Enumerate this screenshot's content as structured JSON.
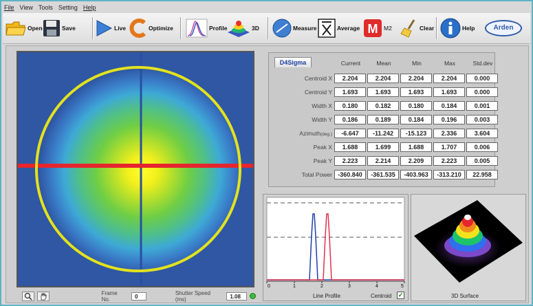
{
  "menu": [
    "File",
    "View",
    "Tools",
    "Setting",
    "Help"
  ],
  "toolbar": {
    "open": "Open",
    "save": "Save",
    "live": "Live",
    "optimize": "Optimize",
    "profile": "Profile",
    "three_d": "3D",
    "measure": "Measure",
    "average": "Average",
    "m2": "M2",
    "clear": "Clear",
    "help": "Help",
    "logo": "Arden"
  },
  "status": {
    "frame_label": "Frame No.",
    "frame_value": "0",
    "shutter_label": "Shutter Speed (ms)",
    "shutter_value": "1.08"
  },
  "stats": {
    "tab": "D4Sigma",
    "columns": [
      "Current",
      "Mean",
      "Min",
      "Max",
      "Std.dev"
    ],
    "rows": [
      {
        "label": "Centroid X",
        "values": [
          "2.204",
          "2.204",
          "2.204",
          "2.204",
          "0.000"
        ]
      },
      {
        "label": "Centroid Y",
        "values": [
          "1.693",
          "1.693",
          "1.693",
          "1.693",
          "0.000"
        ]
      },
      {
        "label": "Width X",
        "values": [
          "0.180",
          "0.182",
          "0.180",
          "0.184",
          "0.001"
        ]
      },
      {
        "label": "Width Y",
        "values": [
          "0.186",
          "0.189",
          "0.184",
          "0.196",
          "0.003"
        ]
      },
      {
        "label": "Azimuth",
        "unit": "(deg.)",
        "values": [
          "-6.647",
          "-11.242",
          "-15.123",
          "2.336",
          "3.604"
        ]
      },
      {
        "label": "Peak X",
        "values": [
          "1.688",
          "1.699",
          "1.688",
          "1.707",
          "0.006"
        ]
      },
      {
        "label": "Peak Y",
        "values": [
          "2.223",
          "2.214",
          "2.209",
          "2.223",
          "0.005"
        ]
      },
      {
        "label": "Total Power",
        "values": [
          "-360.840",
          "-361.535",
          "-403.963",
          "-313.210",
          "22.958"
        ]
      }
    ]
  },
  "line_profile": {
    "caption": "Line Profile",
    "centroid_label": "Centroid",
    "centroid_checked": true,
    "ticks": [
      "0",
      "1",
      "2",
      "3",
      "4",
      "5"
    ],
    "blue_peak_x": 1.7,
    "red_peak_x": 2.2,
    "colors": {
      "blue": "#1f3fa8",
      "red": "#e0304a"
    }
  },
  "surface": {
    "caption": "3D Surface"
  }
}
